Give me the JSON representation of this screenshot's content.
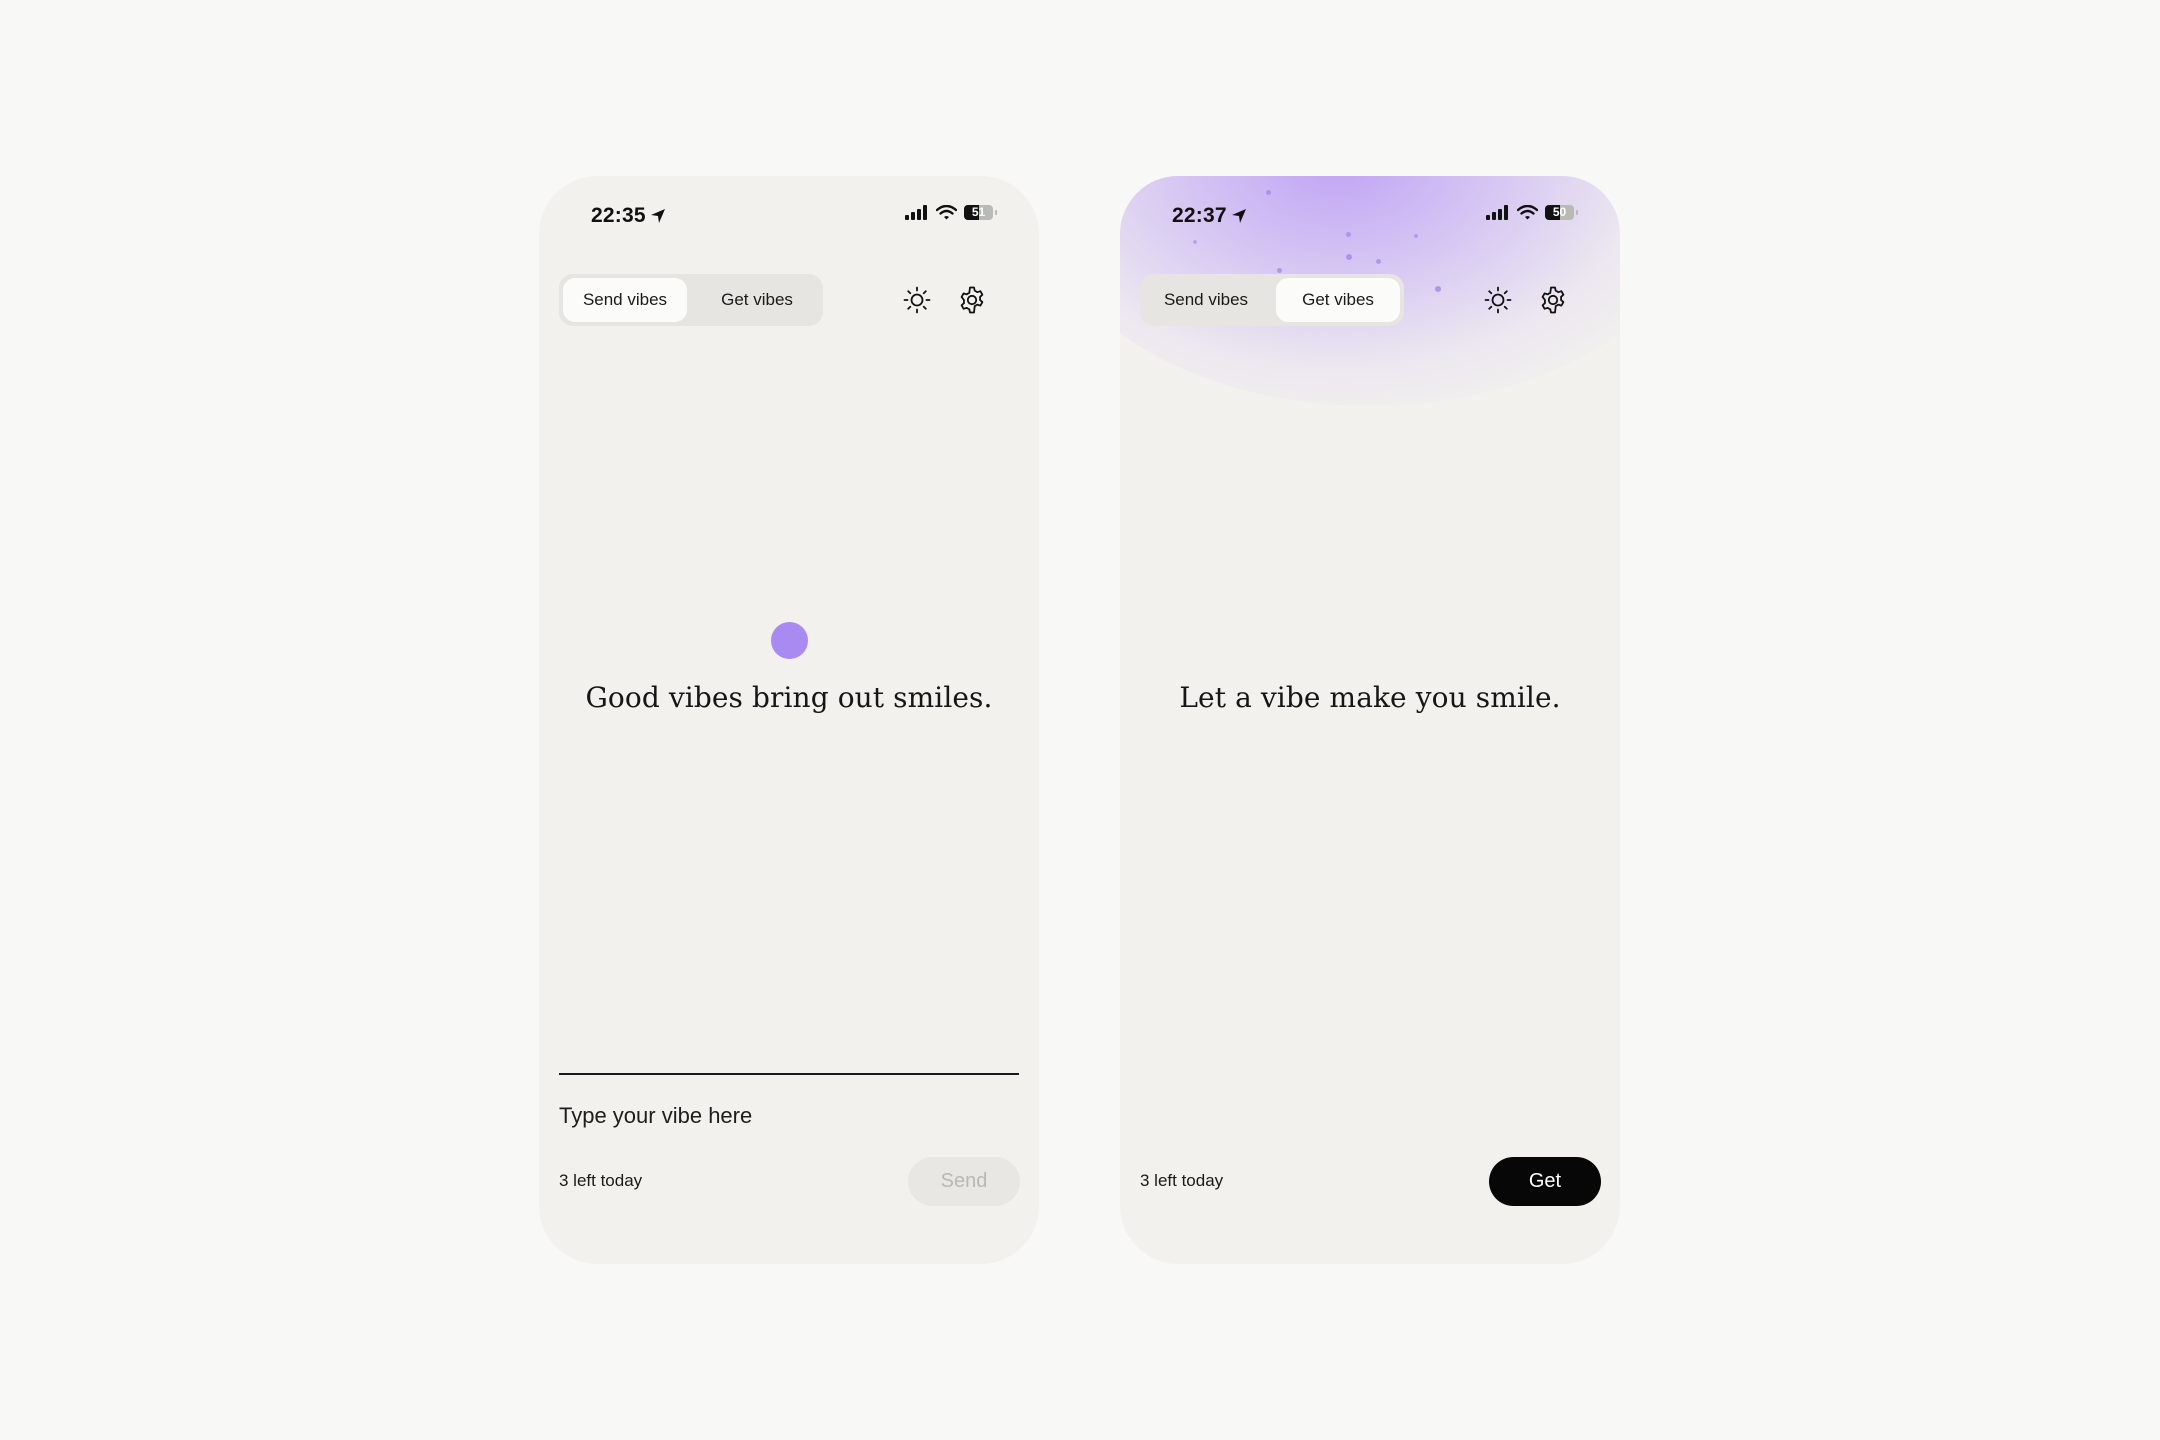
{
  "send_screen": {
    "status": {
      "time": "22:35",
      "battery": "51",
      "battery_level": 0.51
    },
    "tabs": [
      {
        "label": "Send vibes",
        "active": true
      },
      {
        "label": "Get vibes",
        "active": false
      }
    ],
    "icons": {
      "theme": "sun-icon",
      "settings": "gear-icon"
    },
    "accent_color": "#a98af0",
    "headline": "Good vibes bring out smiles.",
    "input": {
      "placeholder": "Type your vibe here",
      "value": ""
    },
    "remaining": "3 left today",
    "button_label": "Send",
    "button_enabled": false
  },
  "get_screen": {
    "status": {
      "time": "22:37",
      "battery": "50",
      "battery_level": 0.5
    },
    "tabs": [
      {
        "label": "Send vibes",
        "active": false
      },
      {
        "label": "Get vibes",
        "active": true
      }
    ],
    "icons": {
      "theme": "sun-icon",
      "settings": "gear-icon"
    },
    "glow_color": "#c3a8f2",
    "headline": "Let a vibe make you smile.",
    "remaining": "3 left today",
    "button_label": "Get",
    "button_enabled": true
  }
}
